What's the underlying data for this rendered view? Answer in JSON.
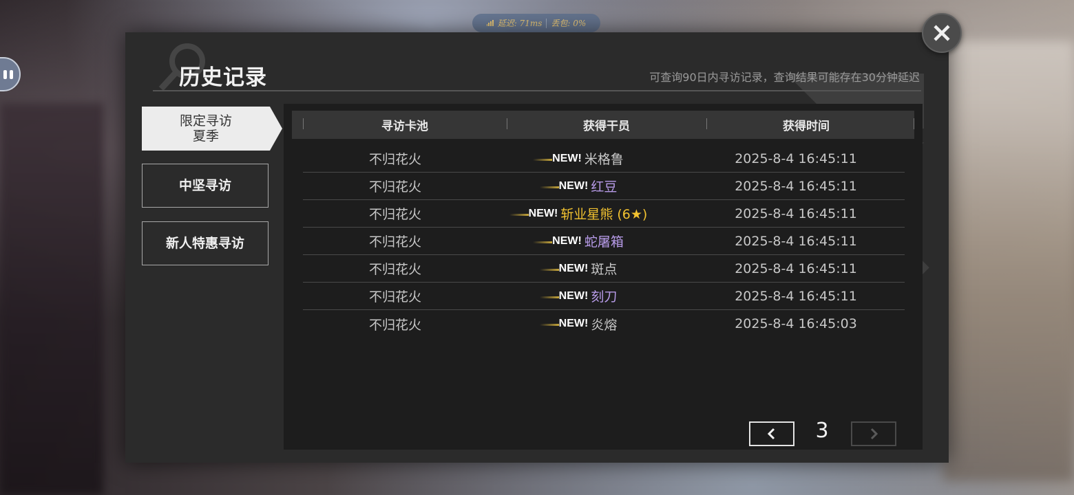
{
  "network": {
    "latency_label": "延迟: 71ms",
    "loss_label": "丢包: 0%"
  },
  "dialog": {
    "title": "历史记录",
    "subtitle": "可查询90日内寻访记录，查询结果可能存在30分钟延迟"
  },
  "tabs": [
    {
      "label_line1": "限定寻访",
      "label_line2": "夏季",
      "active": true
    },
    {
      "label": "中坚寻访",
      "active": false
    },
    {
      "label": "新人特惠寻访",
      "active": false
    }
  ],
  "table": {
    "headers": [
      "寻访卡池",
      "获得干员",
      "获得时间"
    ],
    "rows": [
      {
        "pool": "不归花火",
        "new": "NEW!",
        "operator": "米格鲁",
        "rarity_color": "#c8c8c8",
        "time": "2025-8-4 16:45:11"
      },
      {
        "pool": "不归花火",
        "new": "NEW!",
        "operator": "红豆",
        "rarity_color": "#b79be8",
        "time": "2025-8-4 16:45:11"
      },
      {
        "pool": "不归花火",
        "new": "NEW!",
        "operator": "斩业星熊 (6★)",
        "rarity_color": "#f2c230",
        "time": "2025-8-4 16:45:11"
      },
      {
        "pool": "不归花火",
        "new": "NEW!",
        "operator": "蛇屠箱",
        "rarity_color": "#b79be8",
        "time": "2025-8-4 16:45:11"
      },
      {
        "pool": "不归花火",
        "new": "NEW!",
        "operator": "斑点",
        "rarity_color": "#c8c8c8",
        "time": "2025-8-4 16:45:11"
      },
      {
        "pool": "不归花火",
        "new": "NEW!",
        "operator": "刻刀",
        "rarity_color": "#b79be8",
        "time": "2025-8-4 16:45:11"
      },
      {
        "pool": "不归花火",
        "new": "NEW!",
        "operator": "炎熔",
        "rarity_color": "#c8c8c8",
        "time": "2025-8-4 16:45:03"
      }
    ]
  },
  "pager": {
    "current_page": "3",
    "prev_icon": "chevron-left-icon",
    "next_icon": "chevron-right-icon"
  },
  "icons": {
    "close": "close-icon",
    "signal": "signal-bars-icon",
    "float": "pause-icon"
  }
}
